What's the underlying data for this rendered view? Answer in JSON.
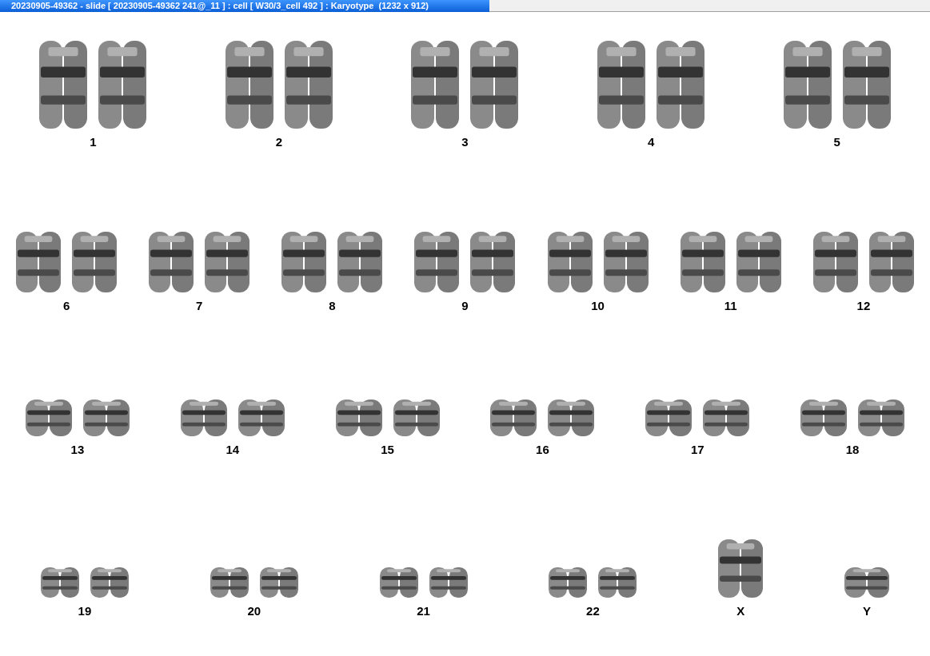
{
  "window": {
    "title": "20230905-49362 - slide [ 20230905-49362 241@_11 ] : cell [ W30/3_cell 492 ] : Karyotype  (1232 x 912)"
  },
  "rows": [
    {
      "groups": [
        {
          "label": "1",
          "kind": "pair"
        },
        {
          "label": "2",
          "kind": "pair"
        },
        {
          "label": "3",
          "kind": "pair"
        },
        {
          "label": "4",
          "kind": "pair"
        },
        {
          "label": "5",
          "kind": "pair"
        }
      ]
    },
    {
      "groups": [
        {
          "label": "6",
          "kind": "pair"
        },
        {
          "label": "7",
          "kind": "pair"
        },
        {
          "label": "8",
          "kind": "pair"
        },
        {
          "label": "9",
          "kind": "pair"
        },
        {
          "label": "10",
          "kind": "pair"
        },
        {
          "label": "11",
          "kind": "pair"
        },
        {
          "label": "12",
          "kind": "pair"
        }
      ]
    },
    {
      "groups": [
        {
          "label": "13",
          "kind": "pair"
        },
        {
          "label": "14",
          "kind": "pair"
        },
        {
          "label": "15",
          "kind": "pair"
        },
        {
          "label": "16",
          "kind": "pair"
        },
        {
          "label": "17",
          "kind": "pair"
        },
        {
          "label": "18",
          "kind": "pair"
        }
      ]
    },
    {
      "groups": [
        {
          "label": "19",
          "kind": "pair"
        },
        {
          "label": "20",
          "kind": "pair"
        },
        {
          "label": "21",
          "kind": "pair"
        },
        {
          "label": "22",
          "kind": "pair"
        },
        {
          "label": "X",
          "kind": "single"
        },
        {
          "label": "Y",
          "kind": "single"
        }
      ]
    }
  ]
}
